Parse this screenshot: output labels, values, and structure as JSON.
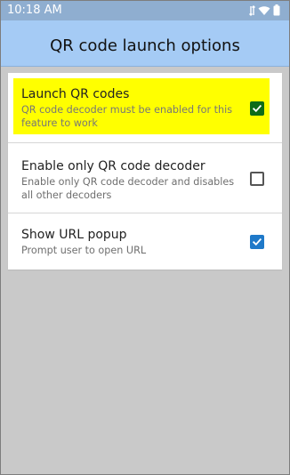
{
  "status": {
    "time": "10:18 AM",
    "icons": [
      "data-arrows-icon",
      "wifi-icon",
      "battery-icon"
    ],
    "colors": {
      "status_bar": "#8faed0",
      "app_bar": "#a5cbf5",
      "highlight": "#ffff00",
      "checkbox_green": "#0e6c18",
      "checkbox_blue": "#1f79c9"
    }
  },
  "appbar": {
    "title": "QR code launch options"
  },
  "list": {
    "items": [
      {
        "title": "Launch QR codes",
        "description": "QR code decoder must be enabled for this feature to work",
        "checked": true
      },
      {
        "title": "Enable only QR code decoder",
        "description": "Enable only QR code decoder and disables all other decoders",
        "checked": false
      },
      {
        "title": "Show URL popup",
        "description": "Prompt user to open URL",
        "checked": true
      }
    ]
  }
}
